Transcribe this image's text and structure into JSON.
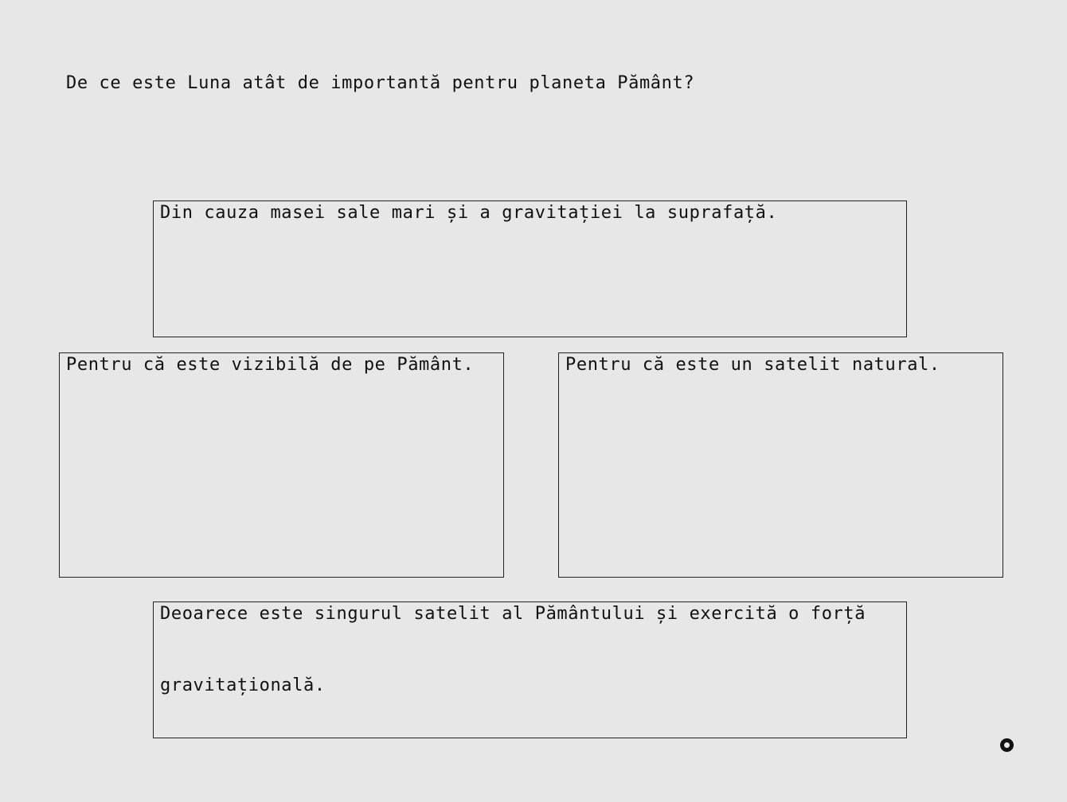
{
  "quiz": {
    "question": "De ce este Luna atât de importantă pentru planeta Pământ?",
    "answers": [
      {
        "label": "Din cauza masei sale mari și a gravitației la suprafață."
      },
      {
        "label": "Pentru că este vizibilă de pe Pământ."
      },
      {
        "label": "Pentru că este un satelit natural."
      },
      {
        "label": "Deoarece este singurul satelit al Pământului și exercită o forță gravitațională."
      }
    ]
  }
}
